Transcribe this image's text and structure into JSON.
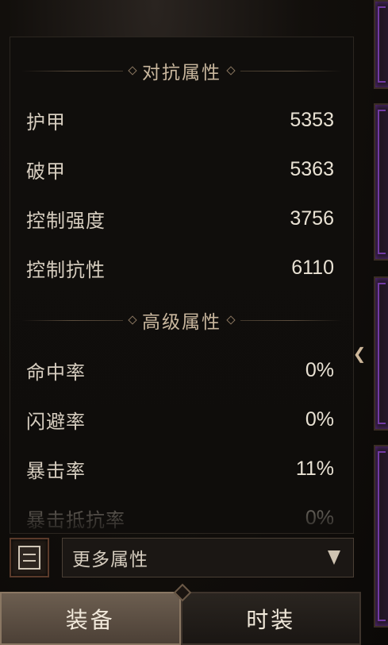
{
  "sections": [
    {
      "title": "对抗属性",
      "stats": [
        {
          "label": "护甲",
          "value": "5353"
        },
        {
          "label": "破甲",
          "value": "5363"
        },
        {
          "label": "控制强度",
          "value": "3756"
        },
        {
          "label": "控制抗性",
          "value": "6110"
        }
      ]
    },
    {
      "title": "高级属性",
      "stats": [
        {
          "label": "命中率",
          "value": "0%"
        },
        {
          "label": "闪避率",
          "value": "0%"
        },
        {
          "label": "暴击率",
          "value": "11%"
        },
        {
          "label": "暴击抵抗率",
          "value": "0%"
        }
      ]
    }
  ],
  "more_attributes": {
    "label": "更多属性",
    "icon": "list-icon",
    "dropdown_icon": "chevron-down-icon"
  },
  "tabs": [
    {
      "label": "装备",
      "active": true
    },
    {
      "label": "时装",
      "active": false
    }
  ],
  "colors": {
    "background": "#0e0b09",
    "panel": "#100e0c",
    "text": "#d6cdbf",
    "accent_purple": "#7c3fb3",
    "active_tab": "#6c5e50"
  }
}
